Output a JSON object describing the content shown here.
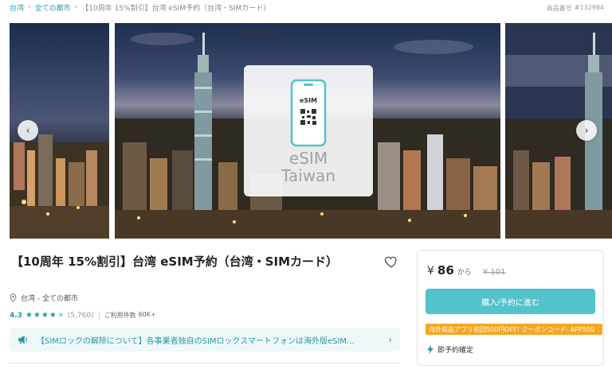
{
  "breadcrumb": {
    "items": [
      "台湾",
      "全ての都市"
    ],
    "current": "【10周年 15%割引】台湾 eSIM予約（台湾・SIMカード）"
  },
  "product_number": {
    "label": "商品番号",
    "value": "#132984"
  },
  "carousel": {
    "esim_title": "eSIM",
    "esim_country": "Taiwan",
    "esim_phone_label": "eSIM",
    "dots": 2,
    "active_dot": 0,
    "prev_icon": "chevron-left-icon",
    "next_icon": "chevron-right-icon"
  },
  "product": {
    "title": "【10周年 15%割引】台湾 eSIM予約（台湾・SIMカード）",
    "location": "台湾 - 全ての都市",
    "rating": "4.3",
    "rating_stars": 4.3,
    "rating_count": "(5,760)",
    "usage_label": "ご利用件数",
    "usage_value": "60K+"
  },
  "notice": {
    "text": "【SIMロックの解除について】各事業者独自のSIMロックスマートフォンは海外版eSIM…",
    "icon": "megaphone-icon"
  },
  "booking": {
    "currency": "¥",
    "price": "86",
    "from": "から",
    "old_price": "¥ 101",
    "buy_label": "購入/予約に進む",
    "coupon": "海外商品アプリ初回500円OFF! クーポンコード: APP500",
    "instant_label": "即予約確定"
  },
  "colors": {
    "accent": "#2a97a4",
    "button": "#52c3cc",
    "coupon": "#f5a623"
  }
}
